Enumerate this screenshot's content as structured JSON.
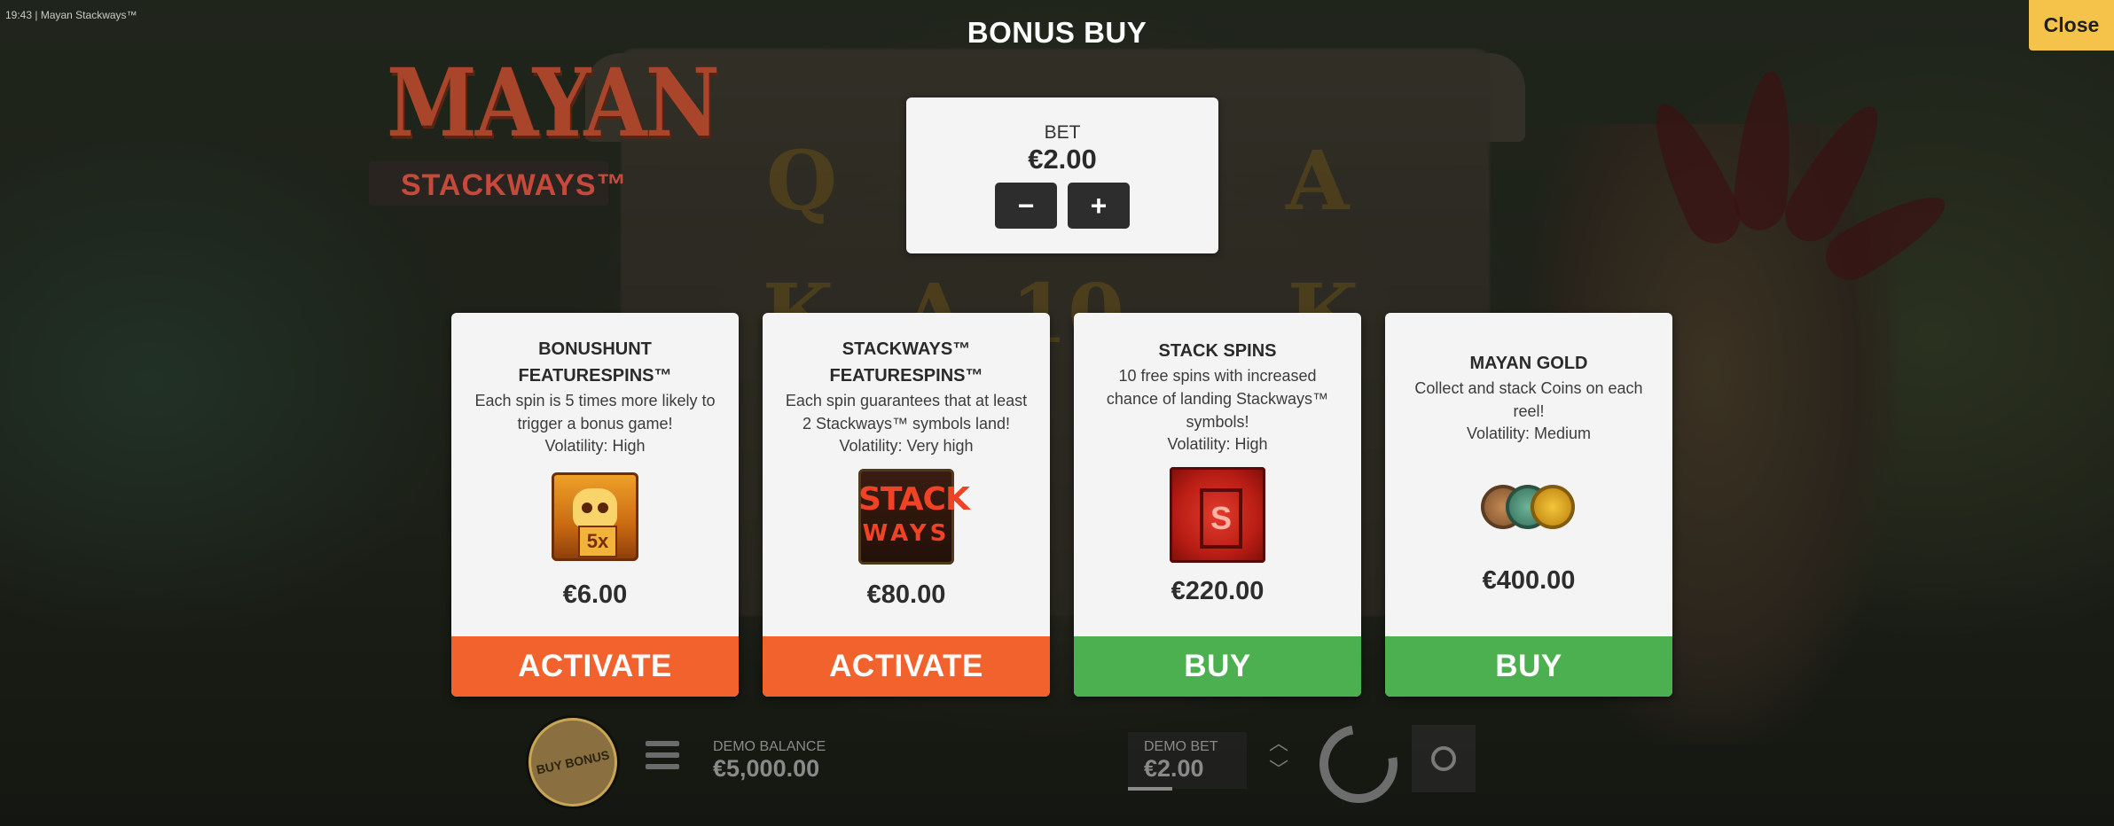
{
  "status_bar": {
    "time": "19:43",
    "game_name": "Mayan Stackways™"
  },
  "header": {
    "title": "BONUS BUY",
    "close_label": "Close"
  },
  "logo": {
    "main": "MAYAN",
    "sub": "STACKWAYS™"
  },
  "bet_panel": {
    "label": "BET",
    "value": "€2.00",
    "minus": "−",
    "plus": "+"
  },
  "cards": [
    {
      "title_lines": [
        "BONUSHUNT",
        "FEATURESPINS™"
      ],
      "desc_lines": [
        "Each spin is 5 times more likely to",
        "trigger a bonus game!"
      ],
      "volatility": "Volatility: High",
      "icon": "skull-5x-icon",
      "icon_text": "5x",
      "price": "€6.00",
      "action": "ACTIVATE",
      "action_color": "#f2622c"
    },
    {
      "title_lines": [
        "STACKWAYS™",
        "FEATURESPINS™"
      ],
      "desc_lines": [
        "Each spin guarantees that at least",
        "2 Stackways™ symbols land!"
      ],
      "volatility": "Volatility: Very high",
      "icon": "stackways-icon",
      "icon_text": [
        "STACK",
        "WAYS"
      ],
      "price": "€80.00",
      "action": "ACTIVATE",
      "action_color": "#f2622c"
    },
    {
      "title_lines": [
        "STACK SPINS"
      ],
      "desc_lines": [
        "10 free spins with increased",
        "chance of landing Stackways™",
        "symbols!"
      ],
      "volatility": "Volatility: High",
      "icon": "red-s-scatter-icon",
      "icon_text": "S",
      "price": "€220.00",
      "action": "BUY",
      "action_color": "#4caf50"
    },
    {
      "title_lines": [
        "MAYAN GOLD"
      ],
      "desc_lines": [
        "Collect and stack Coins on each",
        "reel!"
      ],
      "volatility": "Volatility: Medium",
      "icon": "coins-icon",
      "price": "€400.00",
      "action": "BUY",
      "action_color": "#4caf50"
    }
  ],
  "bottom_bar": {
    "buy_bonus": "BUY BONUS",
    "balance_label": "DEMO BALANCE",
    "balance_value": "€5,000.00",
    "bet_label": "DEMO BET",
    "bet_value": "€2.00"
  },
  "background_symbols": [
    "Q",
    "A",
    "K",
    "A",
    "10",
    "K"
  ]
}
